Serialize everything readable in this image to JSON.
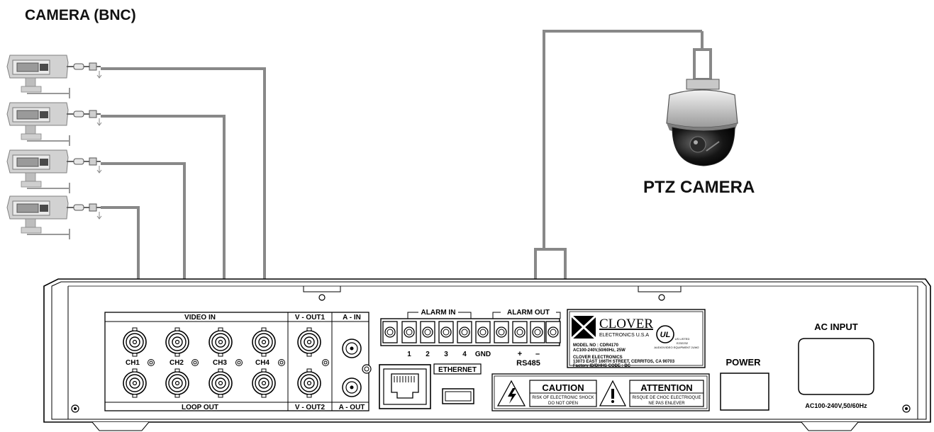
{
  "titles": {
    "camera_bnc": "CAMERA (BNC)",
    "ptz_camera": "PTZ CAMERA"
  },
  "panel": {
    "video_in": "VIDEO IN",
    "loop_out": "LOOP OUT",
    "v_out1": "V - OUT1",
    "v_out2": "V - OUT2",
    "a_in": "A - IN",
    "a_out": "A - OUT",
    "channels": [
      "CH1",
      "CH2",
      "CH3",
      "CH4"
    ],
    "alarm_in": "ALARM IN",
    "alarm_out": "ALARM OUT",
    "alarm_numbers": [
      "1",
      "2",
      "3",
      "4"
    ],
    "gnd": "GND",
    "plus": "+",
    "minus": "–",
    "rs485": "RS485",
    "ethernet": "ETHERNET",
    "power": "POWER",
    "ac_input": "AC INPUT",
    "ac_rating": "AC100-240V,50/60Hz"
  },
  "label": {
    "brand": "CLOVER",
    "brand_sub": "ELECTRONICS U.S.A",
    "model": "MODEL NO  :  CDR4170",
    "rating": "AC100-240V,50/60Hz, 25W",
    "company": "CLOVER ELECTRONICS",
    "address": "13073 EAST 166TH STREET, CERRITOS, CA 90703",
    "factory": "Factory ID/DHHS CODE : BC",
    "ul_listed": "US LISTED",
    "ul_number": "E232232",
    "ul_desc": "AUDIO/VIDEO EQUIPMENT 2UW2"
  },
  "warnings": {
    "caution": "CAUTION",
    "caution_text1": "RISK OF ELECTRONIC SHOCK",
    "caution_text2": "DO NOT OPEN",
    "attention": "ATTENTION",
    "attention_text1": "RISQUE DE CHOC ELECTRIOQUE",
    "attention_text2": "NE PAS ENLEVER"
  }
}
